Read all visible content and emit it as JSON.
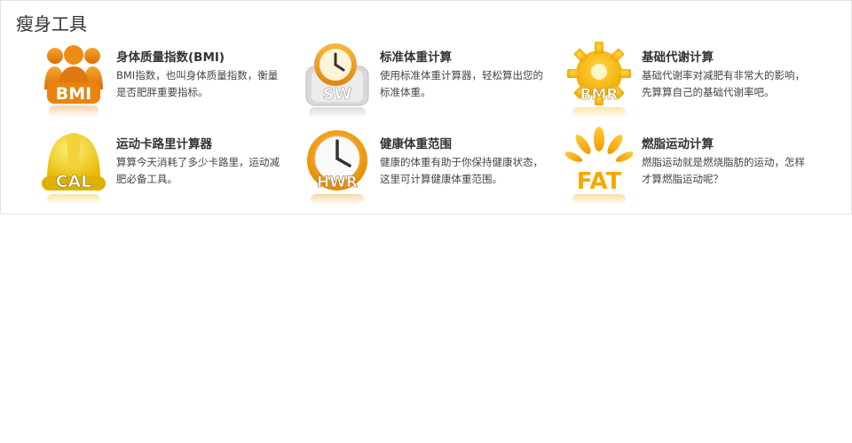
{
  "section": {
    "title": "瘦身工具"
  },
  "tools": [
    {
      "name": "身体质量指数(BMI)",
      "desc": "BMI指数，也叫身体质量指数，衡量是否肥胖重要指标。",
      "icon": "people-icon",
      "badge": "BMI"
    },
    {
      "name": "标准体重计算",
      "desc": "使用标准体重计算器，轻松算出您的标准体重。",
      "icon": "scale-clock-icon",
      "badge": "SW"
    },
    {
      "name": "基础代谢计算",
      "desc": "基础代谢率对减肥有非常大的影响，先算算自己的基础代谢率吧。",
      "icon": "gear-icon",
      "badge": "BMR"
    },
    {
      "name": "运动卡路里计算器",
      "desc": "算算今天消耗了多少卡路里，运动减肥必备工具。",
      "icon": "helmet-icon",
      "badge": "CAL"
    },
    {
      "name": "健康体重范围",
      "desc": "健康的体重有助于你保持健康状态，这里可计算健康体重范围。",
      "icon": "clock-icon",
      "badge": "HWR"
    },
    {
      "name": "燃脂运动计算",
      "desc": "燃脂运动就是燃烧脂肪的运动，怎样才算燃脂运动呢？",
      "icon": "flame-icon",
      "badge": "FAT"
    }
  ],
  "colors": {
    "orange": "#e8840e",
    "yellow": "#f5b800",
    "title": "#333333",
    "text": "#444444"
  }
}
